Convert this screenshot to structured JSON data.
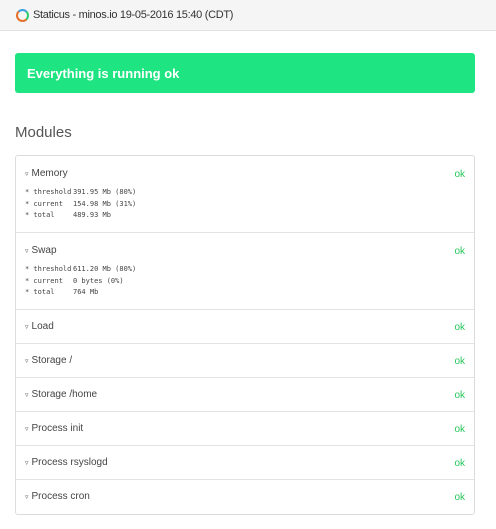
{
  "header": {
    "title": "Staticus - minos.io 19-05-2016 15:40 (CDT)"
  },
  "status": {
    "message": "Everything is running ok"
  },
  "modules_title": "Modules",
  "modules": [
    {
      "name": "Memory",
      "status": "ok",
      "details": [
        {
          "key": "* threshold",
          "value": "391.95 Mb (80%)"
        },
        {
          "key": "* current",
          "value": "154.98 Mb (31%)"
        },
        {
          "key": "* total",
          "value": "489.93 Mb"
        }
      ]
    },
    {
      "name": "Swap",
      "status": "ok",
      "details": [
        {
          "key": "* threshold",
          "value": "611.20 Mb (80%)"
        },
        {
          "key": "* current",
          "value": "0 bytes (0%)"
        },
        {
          "key": "* total",
          "value": "764 Mb"
        }
      ]
    },
    {
      "name": "Load",
      "status": "ok"
    },
    {
      "name": "Storage /",
      "status": "ok"
    },
    {
      "name": "Storage /home",
      "status": "ok"
    },
    {
      "name": "Process init",
      "status": "ok"
    },
    {
      "name": "Process rsyslogd",
      "status": "ok"
    },
    {
      "name": "Process cron",
      "status": "ok"
    }
  ],
  "caret_glyph": "▿",
  "colors": {
    "banner": "#1ee582",
    "ok": "#25c55a"
  },
  "icons": {
    "logo": "staticus-logo-icon",
    "caret": "triangle-down-icon"
  }
}
